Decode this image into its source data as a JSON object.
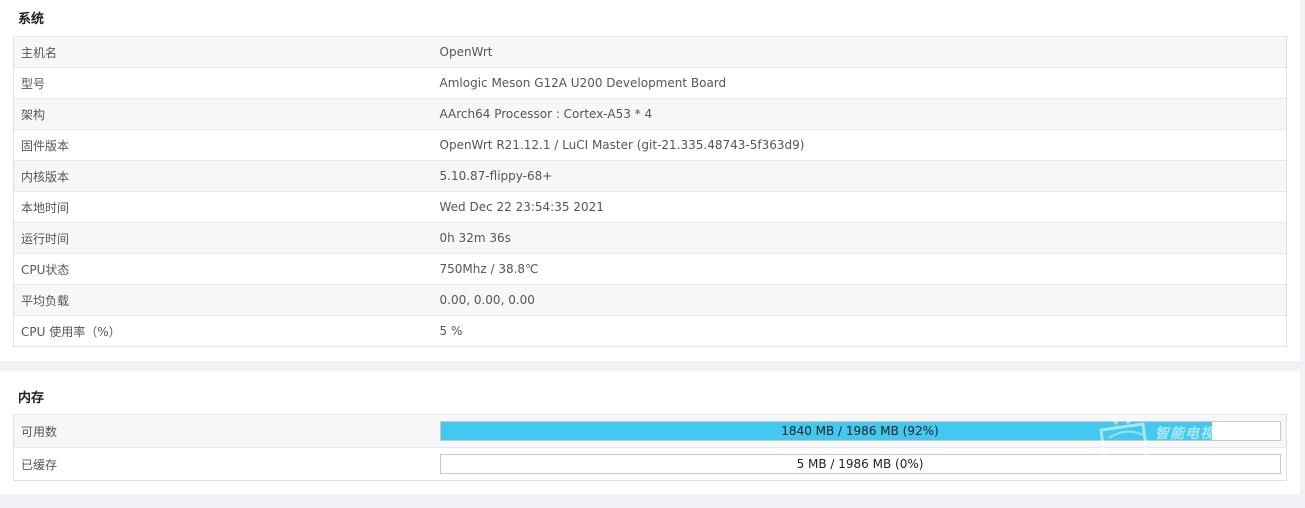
{
  "system": {
    "title": "系统",
    "rows": [
      {
        "label": "主机名",
        "value": "OpenWrt"
      },
      {
        "label": "型号",
        "value": "Amlogic Meson G12A U200 Development Board"
      },
      {
        "label": "架构",
        "value": "AArch64 Processor : Cortex-A53 * 4"
      },
      {
        "label": "固件版本",
        "value": "OpenWrt R21.12.1 / LuCI Master (git-21.335.48743-5f363d9)"
      },
      {
        "label": "内核版本",
        "value": "5.10.87-flippy-68+"
      },
      {
        "label": "本地时间",
        "value": "Wed Dec 22 23:54:35 2021"
      },
      {
        "label": "运行时间",
        "value": "0h 32m 36s"
      },
      {
        "label": "CPU状态",
        "value": "750Mhz / 38.8℃"
      },
      {
        "label": "平均负载",
        "value": "0.00, 0.00, 0.00"
      },
      {
        "label": "CPU 使用率（%）",
        "value": "5 %"
      }
    ]
  },
  "memory": {
    "title": "内存",
    "rows": [
      {
        "label": "可用数",
        "text": "1840 MB / 1986 MB (92%)",
        "percent": 92
      },
      {
        "label": "已缓存",
        "text": "5 MB / 1986 MB (0%)",
        "percent": 0
      }
    ]
  },
  "watermark": {
    "text": "智能电视网",
    "icon": "tv-icon"
  },
  "colors": {
    "bar_fill": "#41c9f0",
    "row_alt": "#f7f7f7",
    "page_bg": "#f0f2f5"
  }
}
